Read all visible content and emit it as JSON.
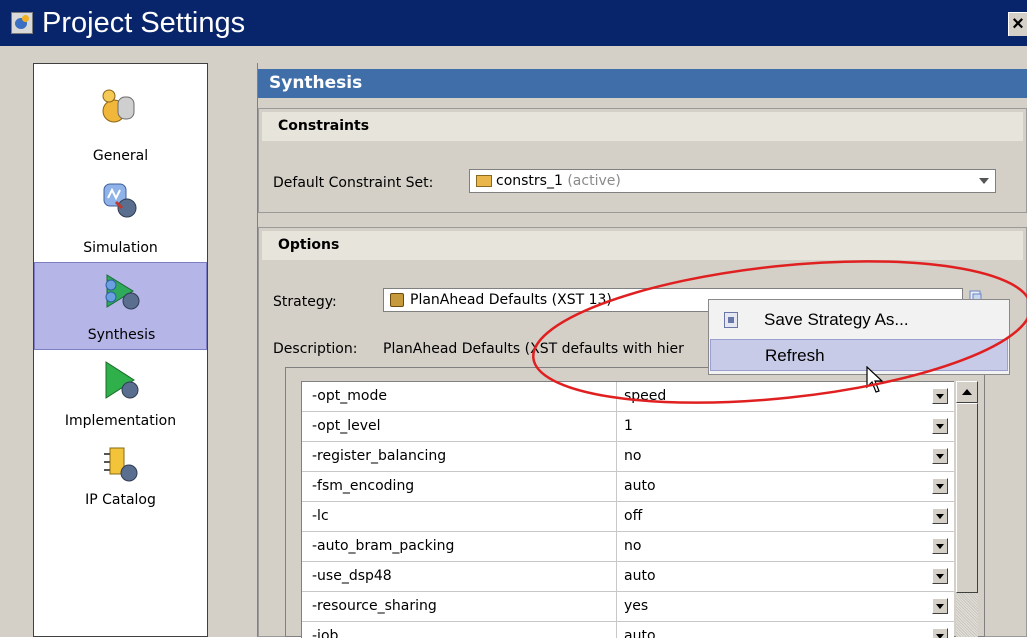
{
  "window": {
    "title": "Project Settings",
    "close": "×"
  },
  "categories": [
    {
      "label": "General",
      "icon": "general-settings-icon"
    },
    {
      "label": "Simulation",
      "icon": "simulation-icon"
    },
    {
      "label": "Synthesis",
      "icon": "synthesis-icon",
      "selected": true
    },
    {
      "label": "Implementation",
      "icon": "implementation-icon"
    },
    {
      "label": "IP Catalog",
      "icon": "ip-catalog-icon"
    }
  ],
  "panel": {
    "title": "Synthesis"
  },
  "constraints": {
    "header": "Constraints",
    "default_set_label": "Default Constraint Set:",
    "default_set_value": "constrs_1",
    "default_set_suffix": "(active)"
  },
  "options": {
    "header": "Options",
    "strategy_label": "Strategy:",
    "strategy_value": "PlanAhead Defaults (XST 13)",
    "description_label": "Description:",
    "description_value": "PlanAhead Defaults (XST defaults with hier"
  },
  "table": {
    "rows": [
      {
        "key": "-opt_mode",
        "value": "speed"
      },
      {
        "key": "-opt_level",
        "value": "1"
      },
      {
        "key": "-register_balancing",
        "value": "no"
      },
      {
        "key": "-fsm_encoding",
        "value": "auto"
      },
      {
        "key": "-lc",
        "value": "off"
      },
      {
        "key": "-auto_bram_packing",
        "value": "no"
      },
      {
        "key": "-use_dsp48",
        "value": "auto"
      },
      {
        "key": "-resource_sharing",
        "value": "yes"
      },
      {
        "key": "-iob",
        "value": "auto"
      }
    ]
  },
  "context_menu": {
    "items": [
      {
        "label": "Save Strategy As...",
        "icon": "save-strategy-icon"
      },
      {
        "label": "Refresh",
        "highlighted": true
      }
    ]
  },
  "colors": {
    "titlebar": "#08246b",
    "section_header": "#3f6ea8",
    "selected_category": "#b5b5e8",
    "annotation_ellipse": "#e02020"
  }
}
